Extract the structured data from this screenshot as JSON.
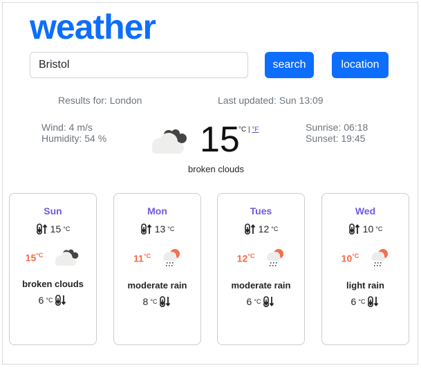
{
  "header": {
    "title": "weather"
  },
  "search": {
    "value": "Bristol",
    "search_label": "search",
    "location_label": "location"
  },
  "status": {
    "results": "Results for: London",
    "updated": "Last updated: Sun 13:09"
  },
  "current": {
    "wind": "Wind: 4 m/s",
    "humidity": "Humidity: 54 %",
    "temp": "15",
    "unit_c": "°C",
    "sep": " | ",
    "unit_f": "°F",
    "description": "broken clouds",
    "icon": "broken-clouds-icon",
    "sunrise": "Sunrise: 06:18",
    "sunset": "Sunset: 19:45"
  },
  "unit": "°C",
  "forecast": [
    {
      "day": "Sun",
      "high": "15",
      "current": "15",
      "description": "broken clouds",
      "low": "6",
      "icon": "broken-clouds"
    },
    {
      "day": "Mon",
      "high": "13",
      "current": "11",
      "description": "moderate rain",
      "low": "8",
      "icon": "rain"
    },
    {
      "day": "Tues",
      "high": "12",
      "current": "12",
      "description": "moderate rain",
      "low": "6",
      "icon": "rain"
    },
    {
      "day": "Wed",
      "high": "10",
      "current": "10",
      "description": "light rain",
      "low": "6",
      "icon": "rain"
    }
  ],
  "colors": {
    "accent": "#0d6efd",
    "day": "#6f5ae0",
    "current_temp": "#f46a45"
  }
}
